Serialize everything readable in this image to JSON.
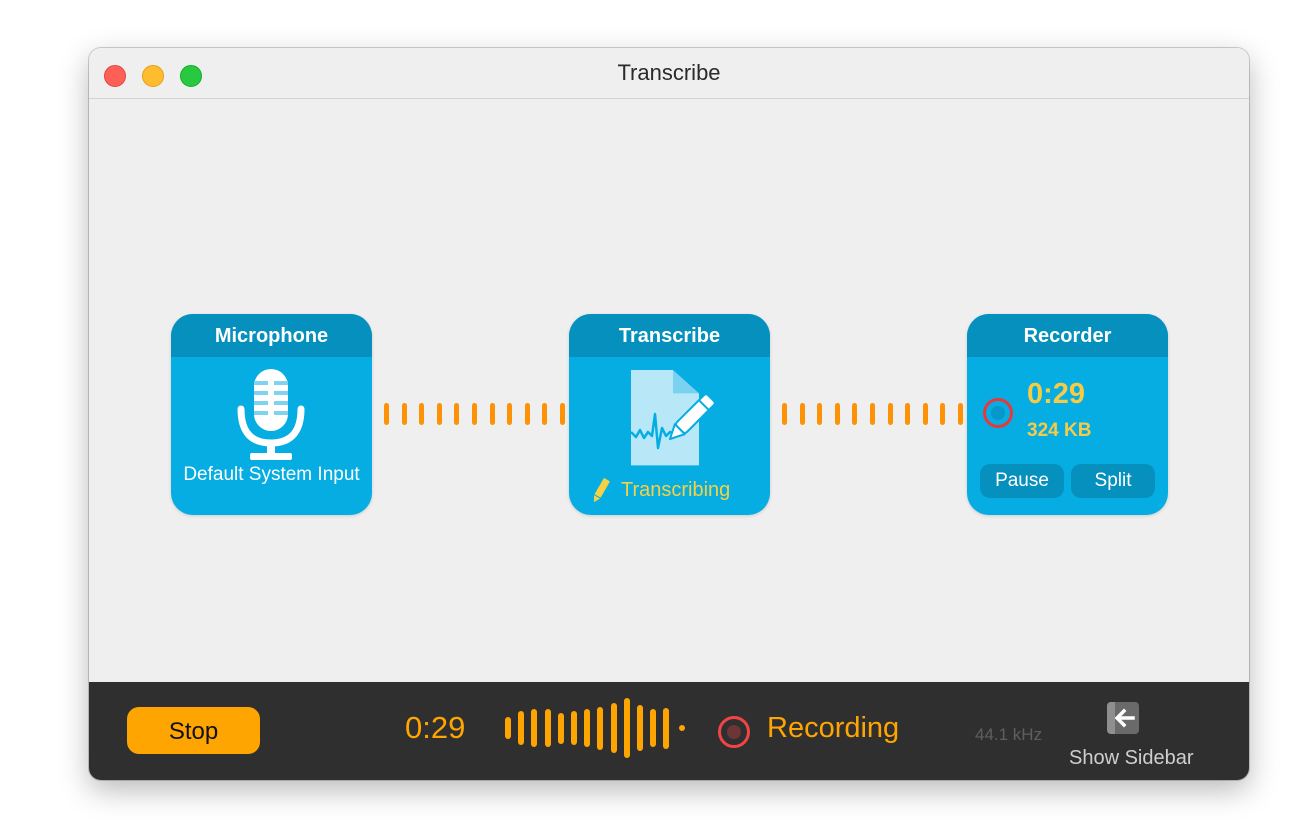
{
  "window": {
    "title": "Transcribe",
    "controls": {
      "close": "close-button",
      "minimize": "minimize-button",
      "zoom": "zoom-button"
    }
  },
  "nodes": {
    "microphone": {
      "header": "Microphone",
      "icon": "microphone-icon",
      "label": "Default System Input"
    },
    "transcribe": {
      "header": "Transcribe",
      "icon": "document-waveform-pencil-icon",
      "status_icon": "pencil-icon",
      "status": "Transcribing"
    },
    "recorder": {
      "header": "Recorder",
      "indicator_icon": "record-indicator-icon",
      "time": "0:29",
      "size": "324 KB",
      "pause_label": "Pause",
      "split_label": "Split"
    }
  },
  "connectors": {
    "dash_count": 11,
    "color": "#fd9207"
  },
  "bottom_bar": {
    "stop_label": "Stop",
    "elapsed": "0:29",
    "level_meter": [
      0.36,
      0.56,
      0.63,
      0.63,
      0.52,
      0.56,
      0.63,
      0.72,
      0.83,
      1.0,
      0.76,
      0.63,
      0.68
    ],
    "status_icon": "record-icon",
    "status": "Recording",
    "sample_rate": "44.1 kHz",
    "sidebar_icon": "show-sidebar-arrow-icon",
    "sidebar_label": "Show Sidebar"
  },
  "colors": {
    "accent_orange": "#fea502",
    "node_blue": "#05ade3",
    "node_header_blue": "#0690be",
    "status_yellow": "#f7cb45",
    "record_red": "#e8383d"
  }
}
